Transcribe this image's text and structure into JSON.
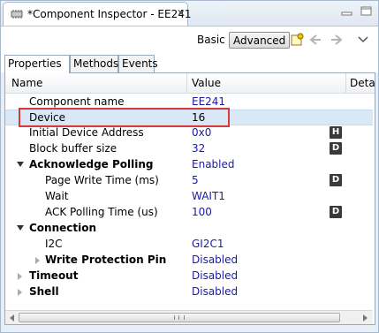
{
  "editor_tab": {
    "title": "*Component Inspector - EE241",
    "close": "✕"
  },
  "toolbar": {
    "basic_label": "Basic",
    "advanced_label": "Advanced"
  },
  "subtabs": [
    "Properties",
    "Methods",
    "Events"
  ],
  "columns": {
    "name": "Name",
    "value": "Value",
    "description": "Deta"
  },
  "rows": [
    {
      "name": "Component name",
      "value": "EE241"
    },
    {
      "name": "Device",
      "value": "16"
    },
    {
      "name": "Initial Device Address",
      "value": "0x0",
      "badge": "H"
    },
    {
      "name": "Block buffer size",
      "value": "32",
      "badge": "D"
    },
    {
      "name": "Acknowledge Polling",
      "value": "Enabled"
    },
    {
      "name": "Page Write Time (ms)",
      "value": "5",
      "badge": "D"
    },
    {
      "name": "Wait",
      "value": "WAIT1"
    },
    {
      "name": "ACK Polling Time (us)",
      "value": "100",
      "badge": "D"
    },
    {
      "name": "Connection",
      "value": ""
    },
    {
      "name": "I2C",
      "value": "GI2C1"
    },
    {
      "name": "Write Protection Pin",
      "value": "Disabled"
    },
    {
      "name": "Timeout",
      "value": "Disabled"
    },
    {
      "name": "Shell",
      "value": "Disabled"
    }
  ],
  "colors": {
    "value_text": "#1a1aa6",
    "highlight_box": "#d8393a",
    "selected_row": "#d9e8f7"
  }
}
